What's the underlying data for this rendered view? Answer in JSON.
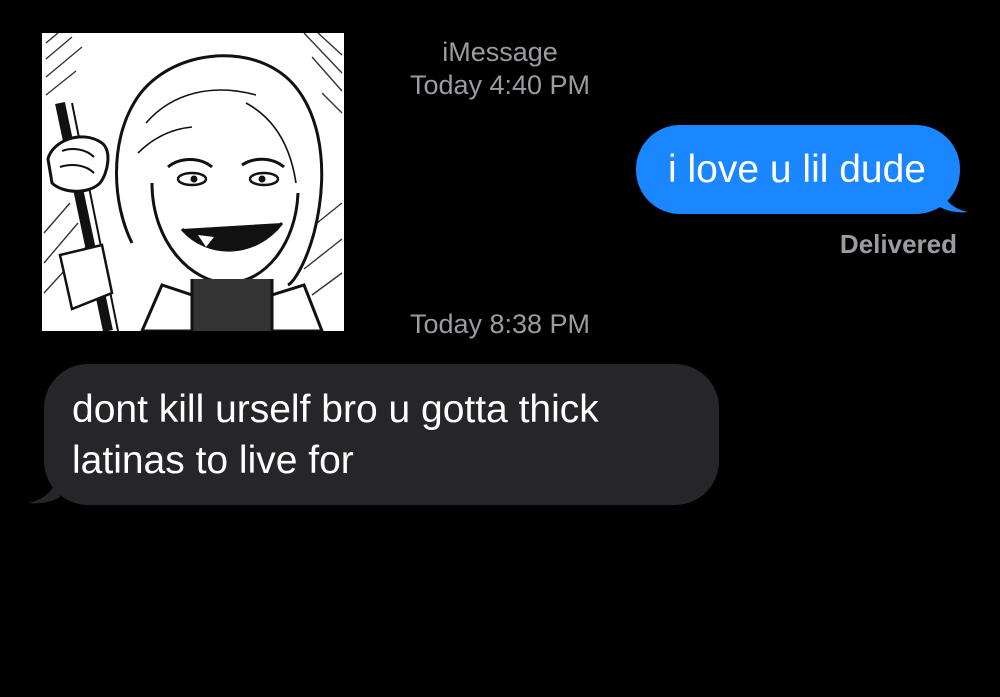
{
  "conversation": {
    "service_label": "iMessage",
    "timestamp_1": "Today 4:40 PM",
    "timestamp_2": "Today 8:38 PM",
    "delivery_status": "Delivered"
  },
  "messages": [
    {
      "direction": "sent",
      "text": "i love u lil dude"
    },
    {
      "direction": "received",
      "text": "dont kill urself bro u gotta thick latinas to live for"
    }
  ],
  "attachment": {
    "type": "image",
    "subject": "manga-style drawing of a grinning blonde character"
  },
  "colors": {
    "background": "#000000",
    "sent_bubble": "#1a86ff",
    "received_bubble": "#26262a",
    "meta_text": "#9b9ba0"
  }
}
